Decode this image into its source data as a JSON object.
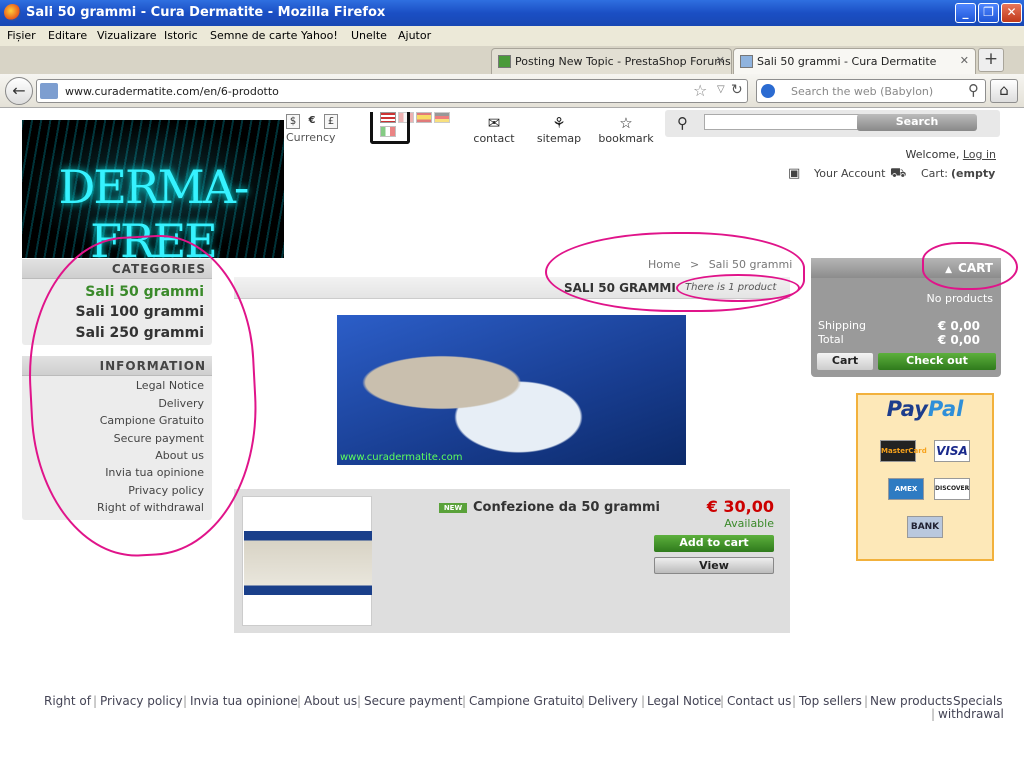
{
  "window": {
    "title": "Sali 50 grammi - Cura Dermatite - Mozilla Firefox",
    "minimize": "_",
    "restore": "❐",
    "close": "✕"
  },
  "menu": [
    "Fișier",
    "Editare",
    "Vizualizare",
    "Istoric",
    "Semne de carte",
    "Yahoo!",
    "Unelte",
    "Ajutor"
  ],
  "tabs": [
    {
      "label": "Posting New Topic - PrestaShop Forums",
      "close": "✕"
    },
    {
      "label": "Sali 50 grammi - Cura Dermatite",
      "close": "✕"
    }
  ],
  "newtab": "+",
  "nav": {
    "back": "←",
    "url": "www.curadermatite.com/en/6-prodotto",
    "search_placeholder": "Search the web (Babylon)",
    "home": "⌂",
    "star": "☆",
    "dropdown": "▽",
    "reload": "↻",
    "search_glyph": "⚲"
  },
  "header": {
    "logo_text": "DERMA-FREE",
    "currency": {
      "symbols": [
        "$",
        "€",
        "£"
      ],
      "label": "Currency"
    },
    "links": [
      {
        "icon": "✉",
        "label": "contact"
      },
      {
        "icon": "⚘",
        "label": "sitemap"
      },
      {
        "icon": "☆",
        "label": "bookmark"
      }
    ],
    "search": {
      "button": "Search",
      "value": "",
      "glyph": "⚲"
    },
    "welcome": "Welcome,",
    "login": "Log in",
    "account": "Your Account",
    "cart_label": "Cart:",
    "cart_state": "(empty"
  },
  "categories": {
    "title": "CATEGORIES",
    "items": [
      "Sali 50 grammi",
      "Sali 100 grammi",
      "Sali 250 grammi"
    ],
    "selected": 0
  },
  "information": {
    "title": "INFORMATION",
    "items": [
      "Legal Notice",
      "Delivery",
      "Campione Gratuito",
      "Secure payment",
      "About us",
      "Invia tua opinione",
      "Privacy policy",
      "Right of withdrawal"
    ]
  },
  "breadcrumb": {
    "home": "Home",
    "sep": ">",
    "current": "Sali 50 grammi"
  },
  "category_title": "SALI 50 GRAMMI",
  "product_count": "There is 1 product",
  "category_image_watermark": "www.curadermatite.com",
  "product": {
    "badge": "NEW",
    "name": "Confezione da 50 grammi",
    "price": "€ 30,00",
    "availability": "Available",
    "add_to_cart": "Add to cart",
    "view": "View"
  },
  "cart": {
    "title": "CART",
    "title_arrow": "▲",
    "empty": "No products",
    "shipping_label": "Shipping",
    "shipping_value": "€ 0,00",
    "total_label": "Total",
    "total_value": "€ 0,00",
    "cart_button": "Cart",
    "checkout_button": "Check out"
  },
  "paypal": {
    "logo_a": "Pay",
    "logo_b": "Pal",
    "cards": [
      "MasterCard",
      "VISA",
      "AMEX",
      "DISCOVER",
      "BANK"
    ]
  },
  "footer": [
    "Right of",
    "Privacy policy",
    "Invia tua opinione",
    "About us",
    "Secure payment",
    "Campione Gratuito",
    "Delivery",
    "Legal Notice",
    "Contact us",
    "Top sellers",
    "New products",
    "Specials",
    "withdrawal"
  ],
  "colors": {
    "annotation": "#e0148a",
    "green": "#3a8a2a",
    "price": "#c00000"
  }
}
